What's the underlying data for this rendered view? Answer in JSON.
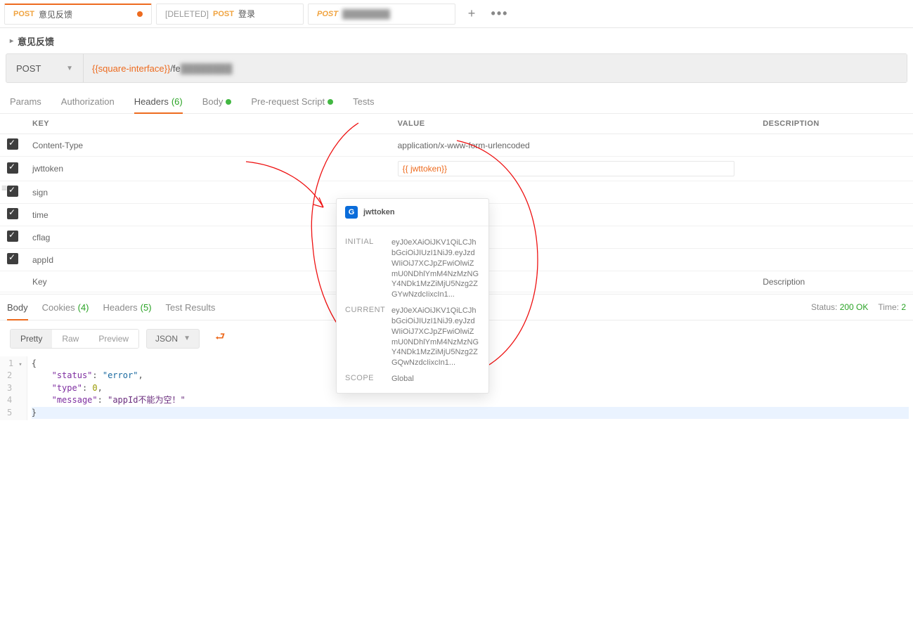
{
  "tabs": [
    {
      "method": "POST",
      "title": "意见反馈",
      "dirty": true,
      "active": true
    },
    {
      "method": "POST",
      "title": "登录",
      "deleted_prefix": "[DELETED]"
    },
    {
      "method": "POST",
      "title": ""
    }
  ],
  "breadcrumb": "意见反馈",
  "request": {
    "method": "POST",
    "url_var": "{{square-interface}}",
    "url_path": "/fe"
  },
  "req_sub_tabs": {
    "params": "Params",
    "authorization": "Authorization",
    "headers": "Headers",
    "headers_count": "(6)",
    "body": "Body",
    "prereq": "Pre-request Script",
    "tests": "Tests"
  },
  "headers_table": {
    "cols": {
      "key": "KEY",
      "value": "VALUE",
      "description": "DESCRIPTION"
    },
    "rows": [
      {
        "key": "Content-Type",
        "value": "application/x-www-form-urlencoded",
        "is_var": false
      },
      {
        "key": "jwttoken",
        "value": "{{ jwttoken}}",
        "is_var": true
      },
      {
        "key": "sign",
        "value": "",
        "is_var": false
      },
      {
        "key": "time",
        "value": "",
        "is_var": false
      },
      {
        "key": "cflag",
        "value": "",
        "is_var": false
      },
      {
        "key": "appId",
        "value": "",
        "is_var": false
      }
    ],
    "new_row": {
      "key_placeholder": "Key",
      "desc_placeholder": "Description"
    }
  },
  "var_popover": {
    "badge": "G",
    "name": "jwttoken",
    "initial_label": "INITIAL",
    "current_label": "CURRENT",
    "scope_label": "SCOPE",
    "scope_value": "Global",
    "initial": "eyJ0eXAiOiJKV1QiLCJhbGciOiJIUzI1NiJ9.eyJzdWIiOiJ7XCJpZFwiOlwiZmU0NDhlYmM4NzMzNGY4NDk1MzZiMjU5Nzg2ZGYwNzdcIixcIn1...",
    "current": "eyJ0eXAiOiJKV1QiLCJhbGciOiJIUzI1NiJ9.eyJzdWIiOiJ7XCJpZFwiOlwiZmU0NDhlYmM4NzMzNGY4NDk1MzZiMjU5Nzg2ZGQwNzdcIixcIn1..."
  },
  "response": {
    "tabs": {
      "body": "Body",
      "cookies": "Cookies",
      "cookies_count": "(4)",
      "headers": "Headers",
      "headers_count": "(5)",
      "test_results": "Test Results"
    },
    "meta": {
      "status_label": "Status:",
      "status_value": "200 OK",
      "time_label": "Time:",
      "time_value": "2"
    },
    "view_modes": {
      "pretty": "Pretty",
      "raw": "Raw",
      "preview": "Preview"
    },
    "format": "JSON",
    "code_lines": [
      "{",
      "    \"status\": \"error\",",
      "    \"type\": 0,",
      "    \"message\": \"appId不能为空！\"",
      "}"
    ]
  }
}
